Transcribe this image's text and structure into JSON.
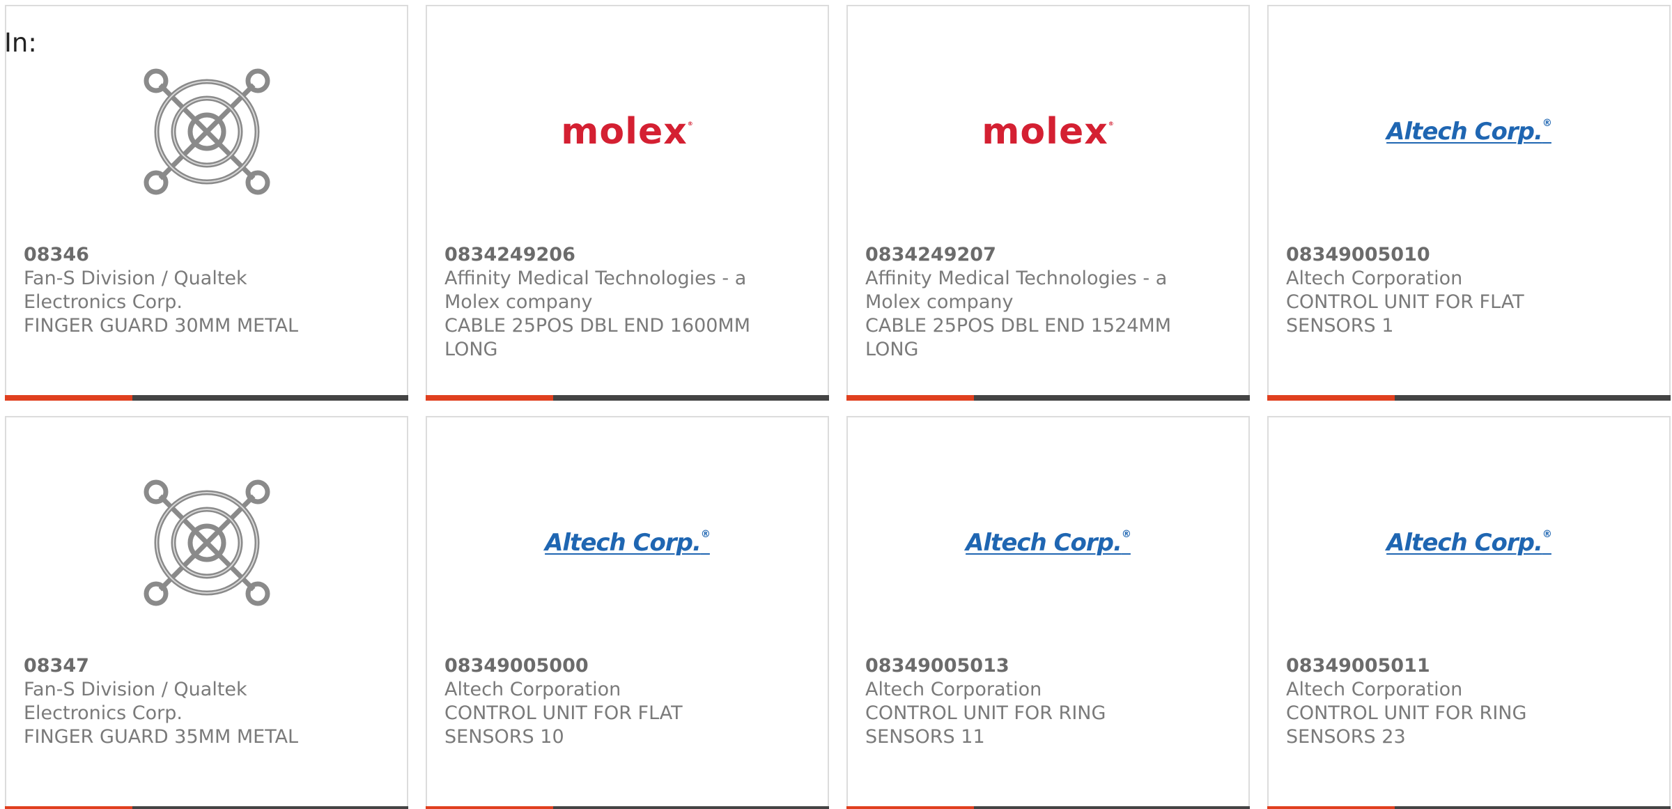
{
  "heading": "In:",
  "products": [
    {
      "part_number": "08346",
      "manufacturer": "Fan-S Division / Qualtek Electronics Corp.",
      "description": "FINGER GUARD 30MM METAL",
      "image": "finger-guard-icon"
    },
    {
      "part_number": "0834249206",
      "manufacturer": "Affinity Medical Technologies - a Molex company",
      "description": "CABLE 25POS DBL END 1600MM LONG",
      "image": "molex-logo",
      "logo_text": "molex",
      "logo_mark": "®"
    },
    {
      "part_number": "0834249207",
      "manufacturer": "Affinity Medical Technologies - a Molex company",
      "description": "CABLE 25POS DBL END 1524MM LONG",
      "image": "molex-logo",
      "logo_text": "molex",
      "logo_mark": "®"
    },
    {
      "part_number": "08349005010",
      "manufacturer": "Altech Corporation",
      "description": "CONTROL UNIT FOR FLAT SENSORS 1",
      "image": "altech-logo",
      "logo_text": "Altech Corp.",
      "logo_mark": "®"
    },
    {
      "part_number": "08347",
      "manufacturer": "Fan-S Division / Qualtek Electronics Corp.",
      "description": "FINGER GUARD 35MM METAL",
      "image": "finger-guard-icon"
    },
    {
      "part_number": "08349005000",
      "manufacturer": "Altech Corporation",
      "description": "CONTROL UNIT FOR FLAT SENSORS 10",
      "image": "altech-logo",
      "logo_text": "Altech Corp.",
      "logo_mark": "®"
    },
    {
      "part_number": "08349005013",
      "manufacturer": "Altech Corporation",
      "description": "CONTROL UNIT FOR RING SENSORS 11",
      "image": "altech-logo",
      "logo_text": "Altech Corp.",
      "logo_mark": "®"
    },
    {
      "part_number": "08349005011",
      "manufacturer": "Altech Corporation",
      "description": "CONTROL UNIT FOR RING SENSORS 23",
      "image": "altech-logo",
      "logo_text": "Altech Corp.",
      "logo_mark": "®"
    }
  ],
  "colors": {
    "accent": "#e0401f",
    "bar": "#444444",
    "molex": "#d42032",
    "altech": "#1f66b2",
    "text": "#7a7a7a"
  }
}
